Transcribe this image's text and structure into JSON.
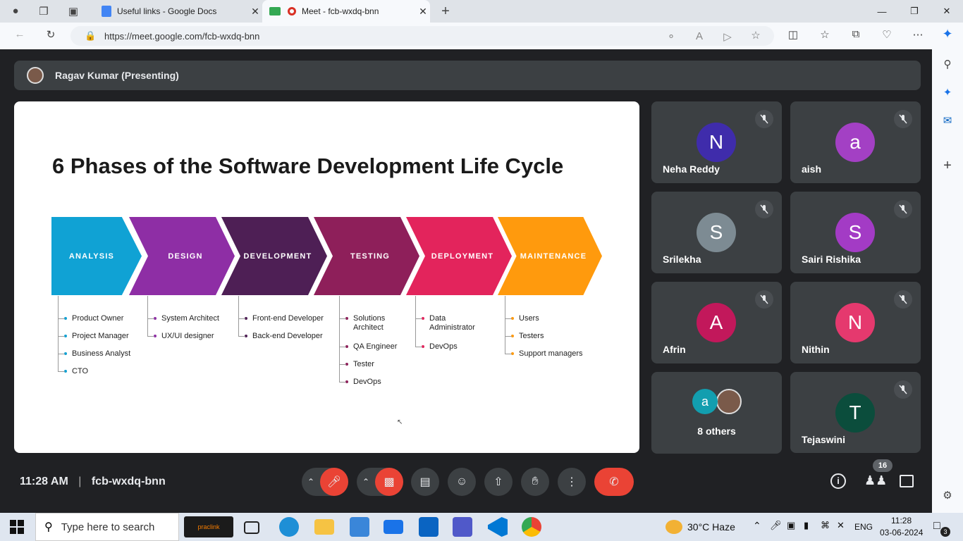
{
  "browser": {
    "tabs": [
      {
        "title": "Useful links - Google Docs",
        "icon": "google-docs-icon"
      },
      {
        "title": "Meet - fcb-wxdq-bnn",
        "icon": "google-meet-icon"
      }
    ],
    "url": "https://meet.google.com/fcb-wxdq-bnn"
  },
  "meet": {
    "presenter_label": "Ragav Kumar (Presenting)",
    "time": "11:28 AM",
    "meeting_code": "fcb-wxdq-bnn",
    "participants_count": "16",
    "accent": "#ea4335"
  },
  "slide": {
    "title": "6 Phases of the Software Development Life Cycle",
    "phases": [
      {
        "name": "ANALYSIS",
        "color": "#10a2d4",
        "items": [
          "Product Owner",
          "Project Manager",
          "Business Analyst",
          "CTO"
        ]
      },
      {
        "name": "DESIGN",
        "color": "#8e2ea5",
        "items": [
          "System Architect",
          "UX/UI designer"
        ]
      },
      {
        "name": "DEVELOPMENT",
        "color": "#4e1f55",
        "items": [
          "Front-end Developer",
          "Back-end Developer"
        ]
      },
      {
        "name": "TESTING",
        "color": "#8e1f5a",
        "items": [
          "Solutions Architect",
          "QA Engineer",
          "Tester",
          "DevOps"
        ]
      },
      {
        "name": "DEPLOYMENT",
        "color": "#e3245c",
        "items": [
          "Data Administrator",
          "DevOps"
        ]
      },
      {
        "name": "MAINTENANCE",
        "color": "#ff9a0d",
        "items": [
          "Users",
          "Testers",
          "Support managers"
        ]
      }
    ]
  },
  "participants": [
    {
      "name": "Neha Reddy",
      "initial": "N",
      "color": "#3f2cab"
    },
    {
      "name": "aish",
      "initial": "a",
      "color": "#a340c4"
    },
    {
      "name": "Srilekha",
      "initial": "S",
      "color": "#7d8b93"
    },
    {
      "name": "Sairi Rishika",
      "initial": "S",
      "color": "#a33bc5"
    },
    {
      "name": "Afrin",
      "initial": "A",
      "color": "#c2185b"
    },
    {
      "name": "Nithin",
      "initial": "N",
      "color": "#e5396e"
    },
    {
      "name": "8 others",
      "initial": "a",
      "color": "#129eaf"
    },
    {
      "name": "Tejaswini",
      "initial": "T",
      "color": "#0b4d3c"
    }
  ],
  "taskbar": {
    "search_placeholder": "Type here to search",
    "weather": "30°C  Haze",
    "lang": "ENG",
    "time": "11:28",
    "date": "03-06-2024",
    "notif_count": "3",
    "pinned_label": "praclink"
  }
}
